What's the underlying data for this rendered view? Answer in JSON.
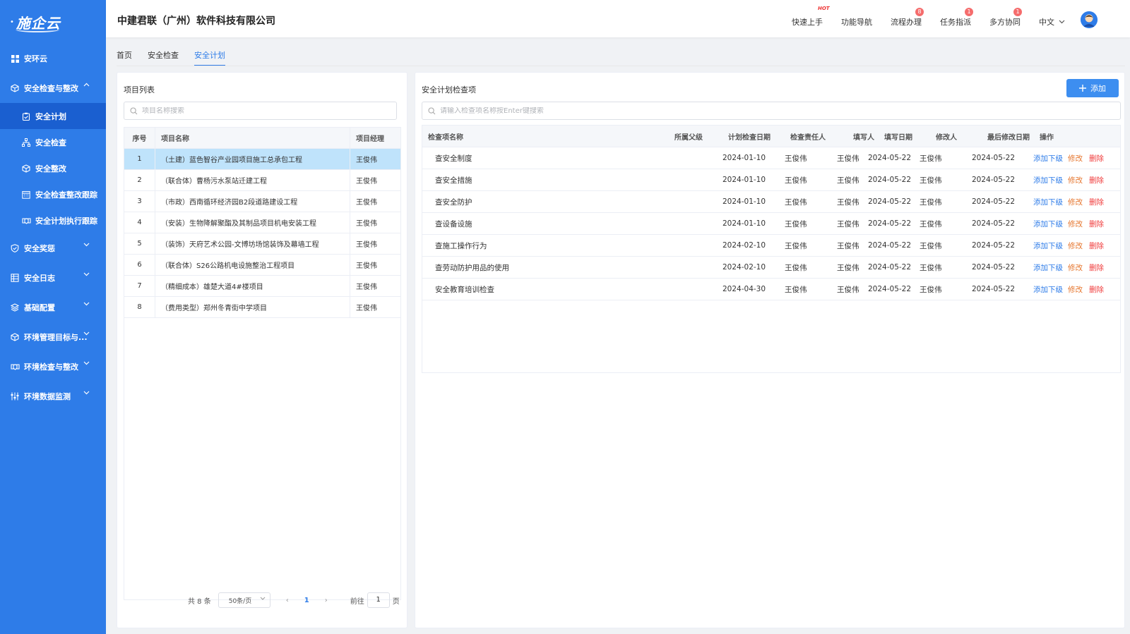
{
  "brand": {
    "logo_text": "施企云"
  },
  "sidebar": {
    "items": [
      {
        "label": "安环云",
        "icon": "grid-icon"
      },
      {
        "label": "安全检查与整改",
        "icon": "cube-icon",
        "expanded": true,
        "children": [
          {
            "label": "安全计划",
            "icon": "clipboard-icon",
            "active": true
          },
          {
            "label": "安全检查",
            "icon": "hierarchy-icon"
          },
          {
            "label": "安全整改",
            "icon": "cube-icon"
          },
          {
            "label": "安全检查整改跟踪",
            "icon": "calendar-icon"
          },
          {
            "label": "安全计划执行跟踪",
            "icon": "handshake-icon"
          }
        ]
      },
      {
        "label": "安全奖惩",
        "icon": "shield-icon"
      },
      {
        "label": "安全日志",
        "icon": "building-icon"
      },
      {
        "label": "基础配置",
        "icon": "layers-icon"
      },
      {
        "label": "环境管理目标与...",
        "icon": "cube-icon"
      },
      {
        "label": "环境检查与整改",
        "icon": "handshake-icon"
      },
      {
        "label": "环境数据监测",
        "icon": "sliders-icon"
      }
    ]
  },
  "header": {
    "company": "中建君联（广州）软件科技有限公司",
    "nav": [
      {
        "label": "快速上手",
        "badge": "HOT"
      },
      {
        "label": "功能导航",
        "badge": ""
      },
      {
        "label": "流程办理",
        "badge": "8"
      },
      {
        "label": "任务指派",
        "badge": "1"
      },
      {
        "label": "多方协同",
        "badge": "1"
      }
    ],
    "language": "中文"
  },
  "tabs": [
    {
      "label": "首页",
      "active": false
    },
    {
      "label": "安全检查",
      "active": false
    },
    {
      "label": "安全计划",
      "active": true
    }
  ],
  "left_panel": {
    "title": "项目列表",
    "search_placeholder": "项目名称搜索",
    "columns": [
      "序号",
      "项目名称",
      "项目经理"
    ],
    "rows": [
      {
        "no": "1",
        "name": "（土建）蓝色智谷产业园项目施工总承包工程",
        "manager": "王俊伟",
        "selected": true
      },
      {
        "no": "2",
        "name": "（联合体）曹杨污水泵站迁建工程",
        "manager": "王俊伟"
      },
      {
        "no": "3",
        "name": "（市政）西南循环经济园B2段道路建设工程",
        "manager": "王俊伟"
      },
      {
        "no": "4",
        "name": "（安装）生物降解聚酯及其制品项目机电安装工程",
        "manager": "王俊伟"
      },
      {
        "no": "5",
        "name": "（装饰）天府艺术公园-文博坊场馆装饰及幕墙工程",
        "manager": "王俊伟"
      },
      {
        "no": "6",
        "name": "（联合体）S26公路机电设施整治工程项目",
        "manager": "王俊伟"
      },
      {
        "no": "7",
        "name": "（精细成本）雄楚大道4#楼项目",
        "manager": "王俊伟"
      },
      {
        "no": "8",
        "name": "（费用类型）郑州冬青街中学项目",
        "manager": "王俊伟"
      }
    ],
    "pagination": {
      "total_text": "共 8 条",
      "page_size": "50条/页",
      "current_page": "1",
      "goto_label": "前往",
      "goto_value": "1",
      "page_suffix": "页"
    }
  },
  "right_panel": {
    "title": "安全计划检查项",
    "add_button": "添加",
    "search_placeholder": "请输入检查项名称按Enter键搜索",
    "columns": {
      "name": "检查项名称",
      "parent": "所属父级",
      "plan_date": "计划检查日期",
      "owner": "检查责任人",
      "filler": "填写人",
      "fill_date": "填写日期",
      "modifier": "修改人",
      "last_modified": "最后修改日期",
      "ops": "操作"
    },
    "rows": [
      {
        "name": "查安全制度",
        "parent": "",
        "plan_date": "2024-01-10",
        "owner": "王俊伟",
        "filler": "王俊伟",
        "fill_date": "2024-05-22",
        "modifier": "王俊伟",
        "last_modified": "2024-05-22"
      },
      {
        "name": "查安全措施",
        "parent": "",
        "plan_date": "2024-01-10",
        "owner": "王俊伟",
        "filler": "王俊伟",
        "fill_date": "2024-05-22",
        "modifier": "王俊伟",
        "last_modified": "2024-05-22"
      },
      {
        "name": "查安全防护",
        "parent": "",
        "plan_date": "2024-01-10",
        "owner": "王俊伟",
        "filler": "王俊伟",
        "fill_date": "2024-05-22",
        "modifier": "王俊伟",
        "last_modified": "2024-05-22"
      },
      {
        "name": "查设备设施",
        "parent": "",
        "plan_date": "2024-01-10",
        "owner": "王俊伟",
        "filler": "王俊伟",
        "fill_date": "2024-05-22",
        "modifier": "王俊伟",
        "last_modified": "2024-05-22"
      },
      {
        "name": "查施工操作行为",
        "parent": "",
        "plan_date": "2024-02-10",
        "owner": "王俊伟",
        "filler": "王俊伟",
        "fill_date": "2024-05-22",
        "modifier": "王俊伟",
        "last_modified": "2024-05-22"
      },
      {
        "name": "查劳动防护用品的使用",
        "parent": "",
        "plan_date": "2024-02-10",
        "owner": "王俊伟",
        "filler": "王俊伟",
        "fill_date": "2024-05-22",
        "modifier": "王俊伟",
        "last_modified": "2024-05-22"
      },
      {
        "name": "安全教育培训检查",
        "parent": "",
        "plan_date": "2024-04-30",
        "owner": "王俊伟",
        "filler": "王俊伟",
        "fill_date": "2024-05-22",
        "modifier": "王俊伟",
        "last_modified": "2024-05-22"
      }
    ],
    "row_actions": {
      "add_child": "添加下级",
      "edit": "修改",
      "delete": "删除"
    }
  },
  "colors": {
    "primary": "#2e7ce8",
    "sidebar_active": "#1a5fd0",
    "selected_row": "#bfe3fb",
    "edit": "#e6762e",
    "delete": "#f03b3b",
    "badge": "#f56c6c"
  }
}
